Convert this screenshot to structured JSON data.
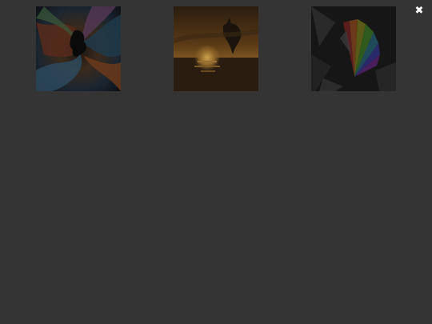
{
  "overlay": {
    "close_label": "✖"
  },
  "thumbnails": [
    {
      "icon": "swirl-dolphin-image",
      "alt": ""
    },
    {
      "icon": "sunset-dolphin-image",
      "alt": ""
    },
    {
      "icon": "rainbow-fan-image",
      "alt": ""
    }
  ],
  "colors": {
    "background": "#343434",
    "close": "#ffffff"
  }
}
